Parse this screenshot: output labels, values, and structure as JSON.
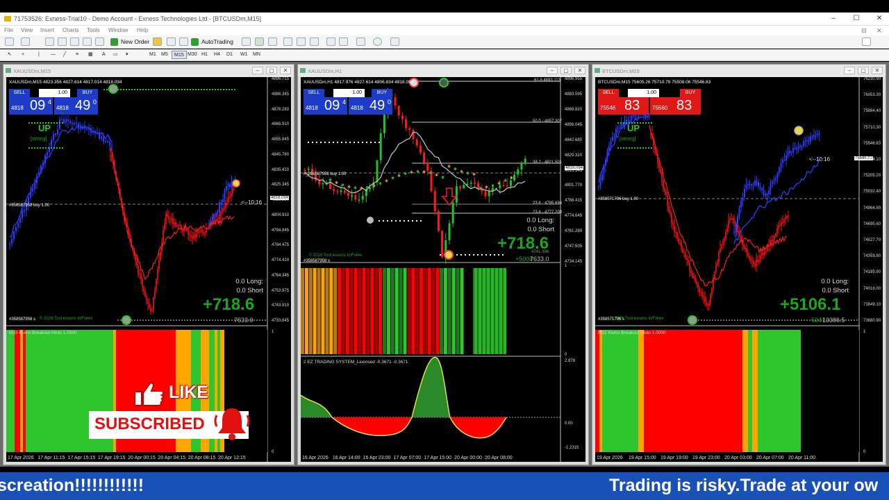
{
  "window": {
    "title": "71753526: Exness-Trial10 - Demo Account - Exness Technologies Ltd - [BTCUSDm,M15]"
  },
  "menu": [
    "File",
    "View",
    "Insert",
    "Charts",
    "Tools",
    "Window",
    "Help"
  ],
  "toolbar": {
    "new_order": "New Order",
    "auto_trading": "AutoTrading",
    "timeframes": [
      "M1",
      "M5",
      "M15",
      "M30",
      "H1",
      "H4",
      "D1",
      "W1",
      "MN"
    ],
    "active_timeframe": "M15"
  },
  "charts": [
    {
      "window_title": "XAUUSDm,M15",
      "symbol_line": "XAUUSDm,M15  4823.356 4827.614 4817.014 4818.094",
      "sell_label": "SELL",
      "buy_label": "BUY",
      "lot": "1.00",
      "sell_price_small": "4818",
      "sell_price_big": "09",
      "sell_price_sup": "4",
      "buy_price_small": "4818",
      "buy_price_big": "49",
      "buy_price_sup": "0",
      "price_axis": [
        "4896.715",
        "4886.345",
        "4876.280",
        "4865.910",
        "4855.845",
        "4845.780",
        "4835.410",
        "4825.345",
        "4815.280",
        "4804.910",
        "4794.845",
        "4784.475",
        "4774.410",
        "4764.345",
        "4753.975",
        "4743.910",
        "4733.845"
      ],
      "current_price": "4818.094",
      "trend_label": "UP",
      "trend_sub": "[strong]",
      "order_label": "#358587958 buy 1.00",
      "timer": "<--10:16",
      "long_label": "0.0  Long:",
      "short_label": "0.0  Short",
      "profit": "+718.6",
      "profit_small": "7633.0",
      "order_bottom": "#358587958 s",
      "site": "© 2026 Tool essons In/Forex",
      "indicator_name": "M15 Kumo Breakout Histo 1.0000",
      "ind_axis": [
        "1",
        "0"
      ],
      "time_axis": [
        "17 Apr 2026",
        "17 Apr 11:15",
        "17 Apr 15:15",
        "17 Apr 19:15",
        "20 Apr 00:15",
        "20 Apr 04:15",
        "20 Apr 08:15",
        "20 Apr 12:15"
      ]
    },
    {
      "window_title": "XAUUSDm,H1",
      "symbol_line": "XAUUSDm,H1  4817.976 4827.614 4806.834 4818.094",
      "sell_label": "SELL",
      "buy_label": "BUY",
      "lot": "1.00",
      "sell_price_small": "4818",
      "sell_price_big": "09",
      "sell_price_sup": "4",
      "buy_price_small": "4818",
      "buy_price_big": "49",
      "buy_price_sup": "0",
      "price_axis": [
        "4896.955",
        "4883.595",
        "4869.820",
        "4856.045",
        "4842.685",
        "4829.320",
        "4815.545",
        "4801.770",
        "4788.415",
        "4774.645",
        "4761.280",
        "4747.505",
        "4734.145"
      ],
      "current_price": "4818.094",
      "fib": [
        "61.8  4893.113",
        "50.0 - 4857.307",
        "38.2 - 4821.501",
        "23.6 - 4785.696",
        "23.6 - 4777.200"
      ],
      "order_label": "#_358587958 buy 1.00",
      "long_label": "0.0  Long:",
      "short_label": "0.0  Short",
      "profit": "+718.6",
      "profit_small_left": "+5004",
      "profit_small": "7633.0",
      "extra_price": "4741.396",
      "order_bottom": "#358587958 s",
      "site": "© 2026 Tool essons In/Forex",
      "ind_axis": [
        "1",
        "0"
      ],
      "osc_name": "2 EZ TRADING SYSTEM_Licensed -0.3671 -0.3671",
      "osc_axis": [
        "2.878",
        "0.00",
        "-1.2315"
      ],
      "time_axis": [
        "16 Apr 2026",
        "16 Apr 14:00",
        "16 Apr 23:00",
        "17 Apr 07:00",
        "17 Apr 15:00",
        "20 Apr 00:00",
        "20 Apr 08:00"
      ]
    },
    {
      "window_title": "BTCUSDm,M15",
      "symbol_line": "BTCUSDm,M15  75605.26 75710.79 75508.06 75546.83",
      "sell_label": "SELL",
      "buy_label": "BUY",
      "lot": "1.00",
      "sell_price_small": "75546",
      "sell_price_big": "83",
      "sell_price_sup": "",
      "buy_price_small": "75560",
      "buy_price_big": "83",
      "buy_price_sup": "",
      "price_axis": [
        "76230.90",
        "76053.30",
        "75884.40",
        "75710.30",
        "75546.83",
        "75374.10",
        "75205.20",
        "75032.40",
        "74864.50",
        "74695.60",
        "74527.70",
        "74359.80",
        "74185.90",
        "74018.00",
        "73849.10",
        "73680.90"
      ],
      "current_price": "75546.83",
      "trend_label": "UP",
      "trend_sub": "[strong]",
      "order_label": "75032.40 buy 1.00",
      "order_prefix": "#358571796 buy 1.00",
      "timer": "<--10:16",
      "long_label": "0.0  Long:",
      "short_label": "0.0  Short",
      "profit": "+5106.1",
      "profit_small": "13386.5",
      "profit_small_left": "5247",
      "order_bottom": "#358571796 s",
      "site": "© 2026 Tool essons In/Forex",
      "indicator_name": "M15 Kumo Breakout Histo 1.0000",
      "ind_axis": [
        "1",
        "0"
      ],
      "time_axis": [
        "19 Apr 2026",
        "19 Apr 15:00",
        "19 Apr 19:00",
        "19 Apr 23:00",
        "20 Apr 03:00",
        "20 Apr 07:00",
        "20 Apr 11:00"
      ]
    }
  ],
  "overlay": {
    "like": "LIKE",
    "subscribed": "SUBSCRIBED"
  },
  "ticker": {
    "left": "screation!!!!!!!!!!!!",
    "right": "Trading is risky.Trade at your ow"
  },
  "colors": {
    "bull": "#2a3cff",
    "bear": "#ff1a1a",
    "histo_green": "#2fc52f",
    "histo_orange": "#ffa500",
    "histo_red": "#ff0000",
    "sell_bg": "#1e3cc8",
    "btc_bg": "#e01818",
    "banner": "#1a51b8"
  }
}
